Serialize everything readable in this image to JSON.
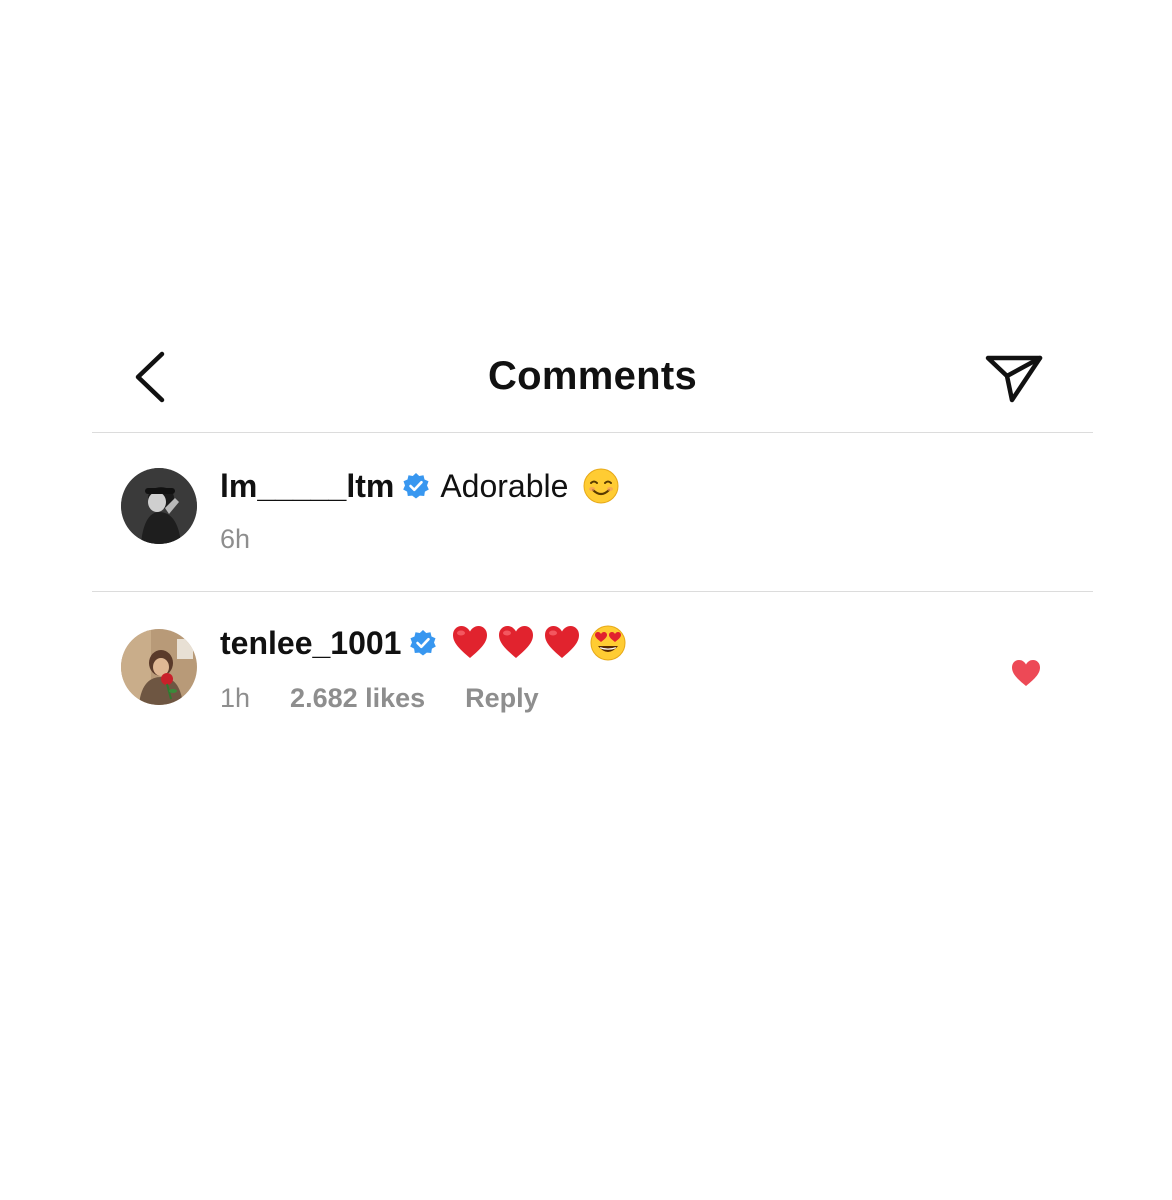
{
  "header": {
    "title": "Comments",
    "back_icon": "chevron-left-icon",
    "share_icon": "send-icon"
  },
  "comments": [
    {
      "username": "lm_____ltm",
      "verified": true,
      "text": "Adorable",
      "emojis": [
        "smiling-face-icon"
      ],
      "time": "6h"
    },
    {
      "username": "tenlee_1001",
      "verified": true,
      "text": "",
      "emojis": [
        "red-heart-icon",
        "red-heart-icon",
        "red-heart-icon",
        "heart-eyes-icon"
      ],
      "time": "1h",
      "likes": "2.682 likes",
      "reply_label": "Reply",
      "liked": true
    }
  ],
  "colors": {
    "verified_blue": "#3897f0",
    "like_red": "#ed4956",
    "secondary_text": "#8e8e8e",
    "divider": "#dcdcdc"
  }
}
